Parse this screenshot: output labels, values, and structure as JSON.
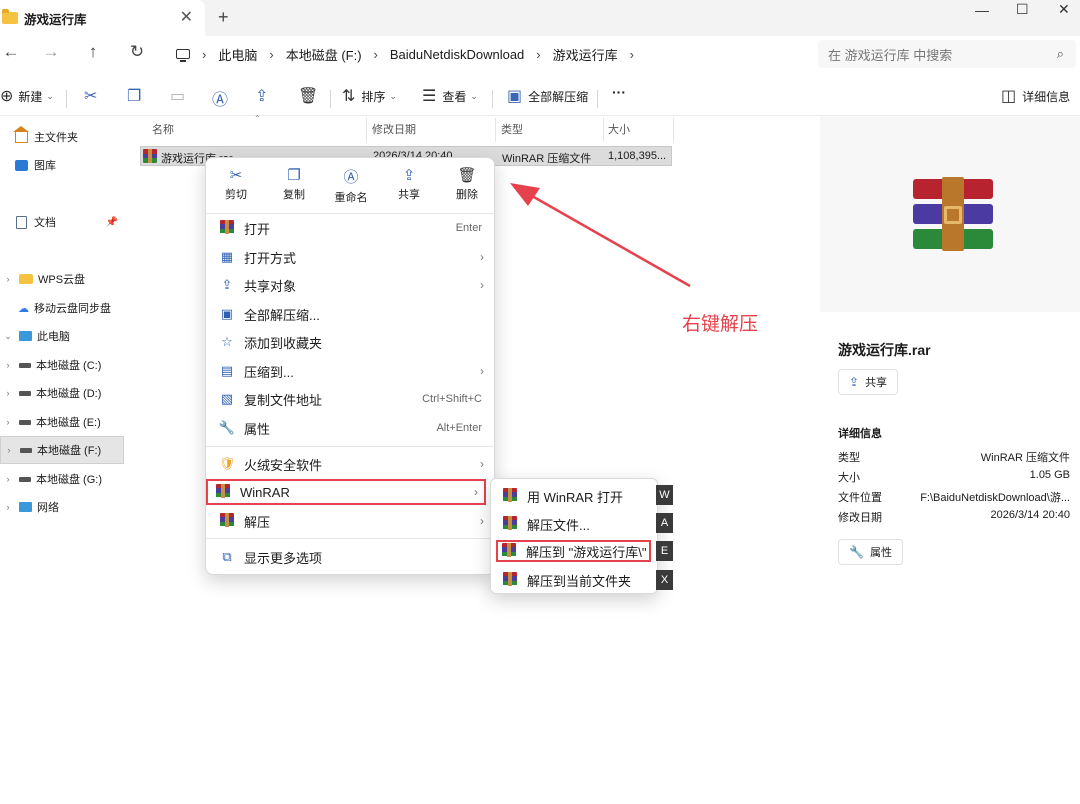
{
  "window": {
    "tab_title": "游戏运行库",
    "tab_close": "✕",
    "new_tab": "+",
    "minimize": "—",
    "maximize": "☐",
    "close": "✕"
  },
  "nav": {
    "back": "←",
    "forward": "→",
    "up": "↑",
    "refresh": "↻",
    "breadcrumb": [
      "此电脑",
      "本地磁盘 (F:)",
      "BaiduNetdiskDownload",
      "游戏运行库"
    ],
    "search_placeholder": "在 游戏运行库 中搜索"
  },
  "commands": {
    "new": "新建",
    "sort": "排序",
    "view": "查看",
    "extract_all": "全部解压缩",
    "more": "···",
    "details": "详细信息"
  },
  "sidebar": {
    "items": [
      {
        "label": "主文件夹"
      },
      {
        "label": "图库"
      },
      {
        "label": "文档"
      },
      {
        "label": "WPS云盘"
      },
      {
        "label": "移动云盘同步盘"
      },
      {
        "label": "此电脑"
      },
      {
        "label": "本地磁盘 (C:)"
      },
      {
        "label": "本地磁盘 (D:)"
      },
      {
        "label": "本地磁盘 (E:)"
      },
      {
        "label": "本地磁盘 (F:)"
      },
      {
        "label": "本地磁盘 (G:)"
      },
      {
        "label": "网络"
      }
    ]
  },
  "filelist": {
    "columns": [
      "名称",
      "修改日期",
      "类型",
      "大小"
    ],
    "rows": [
      {
        "name": "游戏运行库.rar",
        "date": "2026/3/14 20:40",
        "type": "WinRAR 压缩文件",
        "size": "1,108,395..."
      }
    ]
  },
  "context_menu": {
    "quick": [
      "剪切",
      "复制",
      "重命名",
      "共享",
      "删除"
    ],
    "items": [
      {
        "label": "打开",
        "accel": "Enter"
      },
      {
        "label": "打开方式"
      },
      {
        "label": "共享对象"
      },
      {
        "label": "全部解压缩..."
      },
      {
        "label": "添加到收藏夹"
      },
      {
        "label": "压缩到..."
      },
      {
        "label": "复制文件地址",
        "accel": "Ctrl+Shift+C"
      },
      {
        "label": "属性",
        "accel": "Alt+Enter"
      },
      {
        "label": "火绒安全软件"
      },
      {
        "label": "WinRAR"
      },
      {
        "label": "解压"
      },
      {
        "label": "显示更多选项"
      }
    ]
  },
  "submenu": {
    "items": [
      {
        "label": "用 WinRAR 打开",
        "key": "W"
      },
      {
        "label": "解压文件...",
        "key": "A"
      },
      {
        "label": "解压到 \"游戏运行库\\\"",
        "key": "E"
      },
      {
        "label": "解压到当前文件夹",
        "key": "X"
      }
    ]
  },
  "details_pane": {
    "file_name": "游戏运行库.rar",
    "share": "共享",
    "section": "详细信息",
    "rows": [
      {
        "k": "类型",
        "v": "WinRAR 压缩文件"
      },
      {
        "k": "大小",
        "v": "1.05 GB"
      },
      {
        "k": "文件位置",
        "v": "F:\\BaiduNetdiskDownload\\游..."
      },
      {
        "k": "修改日期",
        "v": "2026/3/14 20:40"
      }
    ],
    "properties": "属性"
  },
  "annotation": {
    "text": "右键解压",
    "color": "#e5424d"
  }
}
